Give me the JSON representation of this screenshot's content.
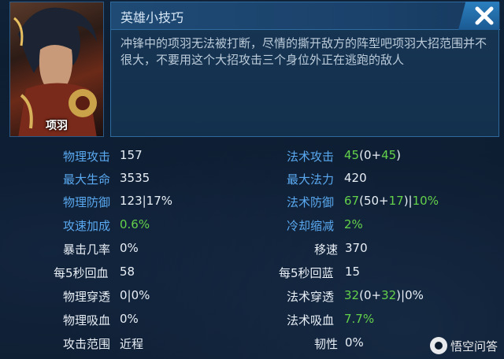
{
  "hero": {
    "name": "项羽"
  },
  "tip": {
    "title": "英雄小技巧",
    "body": "冲锋中的项羽无法被打断，尽情的撕开敌方的阵型吧项羽大招范围并不很大，不要用这个大招攻击三个身位外正在逃跑的敌人"
  },
  "stats": {
    "physical_attack": {
      "label": "物理攻击",
      "value": "157"
    },
    "magic_attack": {
      "label": "法术攻击",
      "base": "45",
      "open": "(0+",
      "bonus": "45",
      "close": ")"
    },
    "max_hp": {
      "label": "最大生命",
      "value": "3535"
    },
    "max_mana": {
      "label": "最大法力",
      "value": "420"
    },
    "physical_defense": {
      "label": "物理防御",
      "value": "123|17%"
    },
    "magic_defense": {
      "label": "法术防御",
      "base": "67",
      "open": "(50+",
      "bonus": "17",
      "sep": ")|",
      "pct": "10%"
    },
    "attack_speed": {
      "label": "攻速加成",
      "value": "0.6%"
    },
    "cooldown": {
      "label": "冷却缩减",
      "value": "2%"
    },
    "crit_rate": {
      "label": "暴击几率",
      "value": "0%"
    },
    "move_speed": {
      "label": "移速",
      "value": "370"
    },
    "hp_regen": {
      "label": "每5秒回血",
      "value": "58"
    },
    "mana_regen": {
      "label": "每5秒回蓝",
      "value": "15"
    },
    "physical_pen": {
      "label": "物理穿透",
      "value": "0|0%"
    },
    "magic_pen": {
      "label": "法术穿透",
      "base": "32",
      "open": "(0+",
      "bonus": "32",
      "sep": ")|",
      "pct": "0%"
    },
    "physical_lifesteal": {
      "label": "物理吸血",
      "value": "0%"
    },
    "magic_lifesteal": {
      "label": "法术吸血",
      "value": "7.7%"
    },
    "attack_range": {
      "label": "攻击范围",
      "value": "近程"
    },
    "tenacity": {
      "label": "韧性",
      "value": "0%"
    }
  },
  "watermark": "悟空问答",
  "colors": {
    "label_blue": "#5aa9f0",
    "value_green": "#63d14a",
    "panel_border": "#2f6a9e"
  },
  "icons": {
    "close": "close-icon",
    "watermark": "wukong-logo-icon"
  }
}
